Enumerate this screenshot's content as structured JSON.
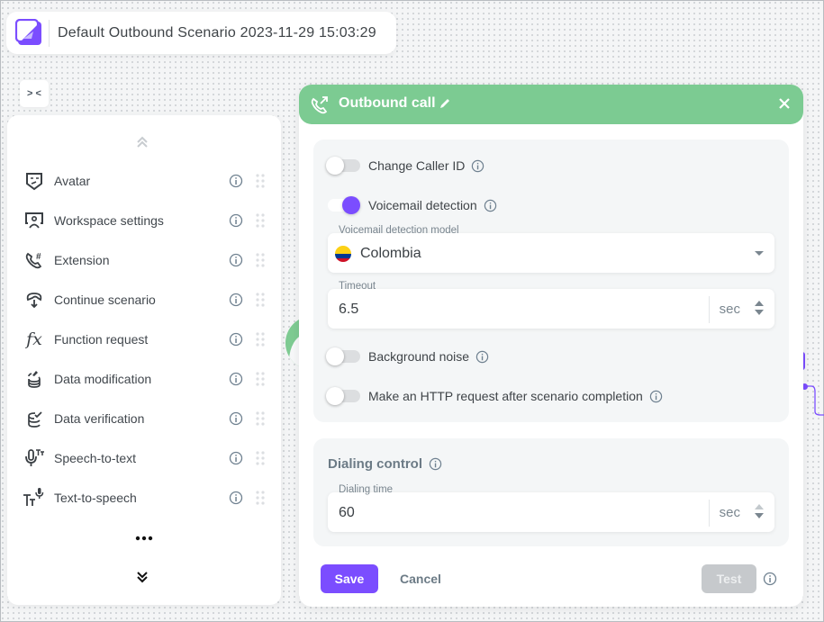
{
  "header": {
    "title": "Default Outbound Scenario 2023-11-29 15:03:29"
  },
  "canvas": {
    "collapse_toggle_label": "> <"
  },
  "palette": {
    "items": [
      {
        "label": "Avatar",
        "icon": "avatar-mask-icon"
      },
      {
        "label": "Workspace settings",
        "icon": "workspace-user-icon"
      },
      {
        "label": "Extension",
        "icon": "phone-hash-icon"
      },
      {
        "label": "Continue scenario",
        "icon": "continue-arrow-icon"
      },
      {
        "label": "Function request",
        "icon": "function-fx-icon"
      },
      {
        "label": "Data modification",
        "icon": "database-edit-icon"
      },
      {
        "label": "Data verification",
        "icon": "database-check-icon"
      },
      {
        "label": "Speech-to-text",
        "icon": "mic-text-icon"
      },
      {
        "label": "Text-to-speech",
        "icon": "text-mic-icon"
      }
    ],
    "more_label": "•••",
    "fx_glyph": "fx"
  },
  "panel": {
    "title": "Outbound call",
    "accent_color": "#7ccb92",
    "settings": {
      "change_caller_id": {
        "label": "Change Caller ID",
        "enabled": false
      },
      "voicemail_detection": {
        "label": "Voicemail detection",
        "enabled": true
      },
      "voicemail_model": {
        "label": "Voicemail detection model",
        "value": "Colombia"
      },
      "timeout": {
        "label": "Timeout",
        "value": "6.5",
        "unit": "sec"
      },
      "background_noise": {
        "label": "Background noise",
        "enabled": false
      },
      "http_request": {
        "label": "Make an HTTP request after scenario completion",
        "enabled": false
      }
    },
    "dialing_control": {
      "title": "Dialing control",
      "dialing_time": {
        "label": "Dialing time",
        "value": "60",
        "unit": "sec"
      }
    },
    "actions": {
      "save": "Save",
      "cancel": "Cancel",
      "test": "Test"
    }
  },
  "colors": {
    "primary": "#7b4dff",
    "node_green": "#7ccb92",
    "disabled": "#c6c9cc"
  }
}
